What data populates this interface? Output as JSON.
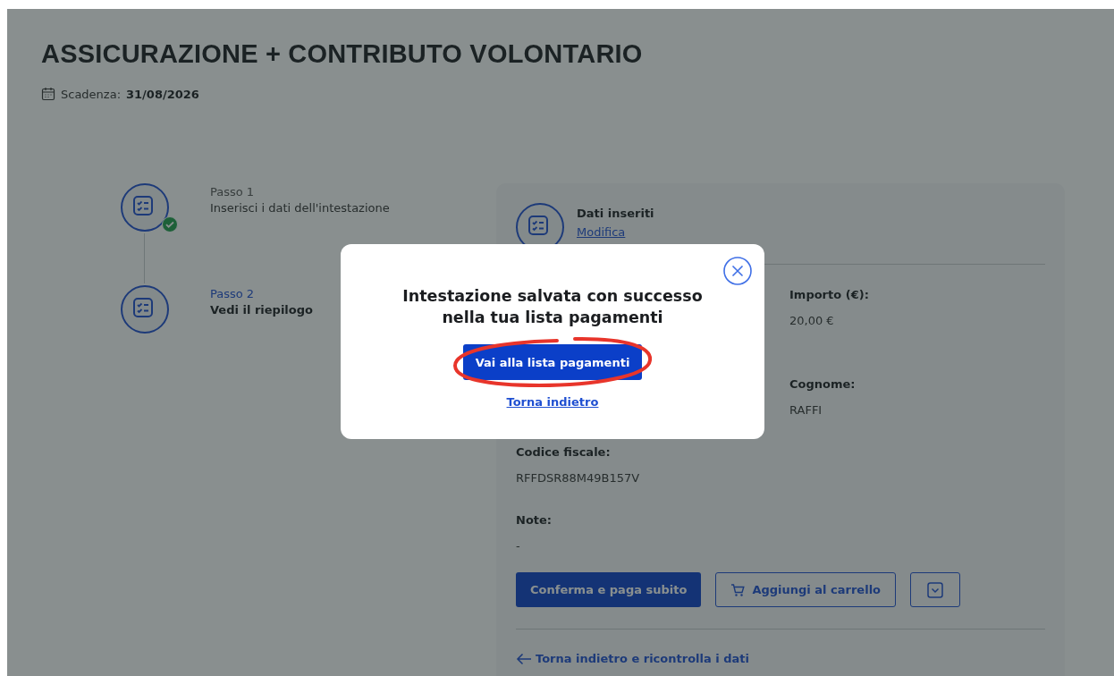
{
  "page": {
    "title": "ASSICURAZIONE + CONTRIBUTO VOLONTARIO",
    "deadline_label": "Scadenza:",
    "deadline": "31/08/2026"
  },
  "steps": [
    {
      "label": "Passo 1",
      "description": "Inserisci i dati dell'intestazione",
      "done": true,
      "selected": false
    },
    {
      "label": "Passo 2",
      "description": "Vedi il riepilogo",
      "done": false,
      "selected": true
    }
  ],
  "summary": {
    "heading": "Dati inseriti",
    "edit_link": "Modifica",
    "rows": [
      {
        "right": {
          "label": "Importo (€):",
          "value": "20,00 €"
        }
      },
      {
        "right": {
          "label": "Cognome:",
          "value": "RAFFI"
        }
      },
      {
        "left": {
          "label": "Codice fiscale:",
          "value": "RFFDSR88M49B157V"
        }
      },
      {
        "left": {
          "label": "Note:",
          "value": "-"
        }
      }
    ],
    "buttons": [
      {
        "kind": "primary",
        "label": "Conferma e paga subito"
      },
      {
        "kind": "cart",
        "label": "Aggiungi al carrello"
      },
      {
        "kind": "menu"
      }
    ],
    "back_link": "Torna indietro e ricontrolla i dati"
  },
  "modal": {
    "message": "Intestazione salvata con successo nella tua lista pagamenti",
    "primary_button": "Vai alla lista pagamenti",
    "secondary_link": "Torna indietro",
    "highlighted": true
  }
}
